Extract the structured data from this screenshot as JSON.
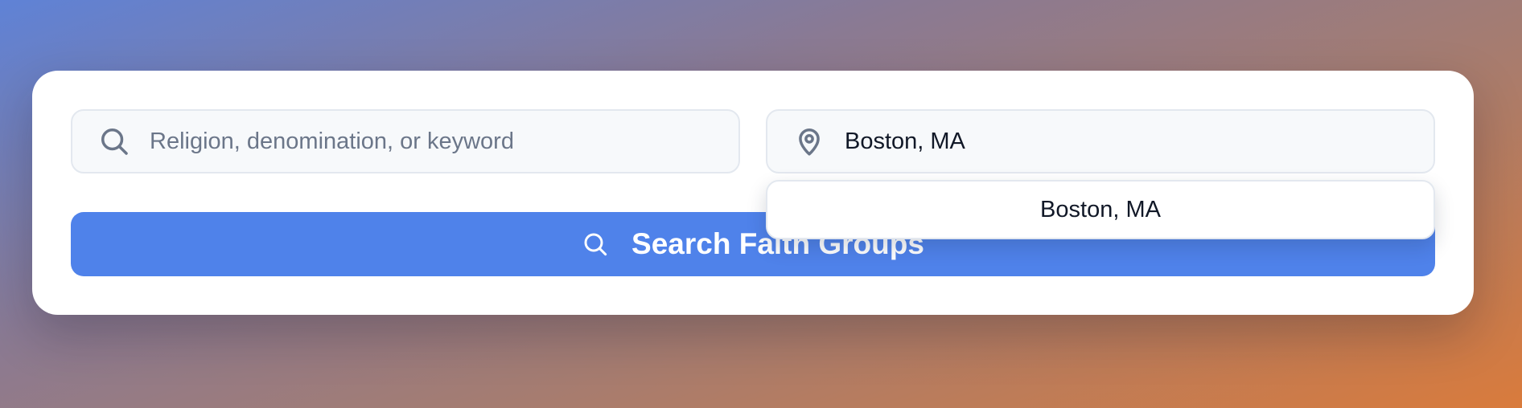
{
  "search_panel": {
    "keyword_field": {
      "icon": "search-icon",
      "placeholder": "Religion, denomination, or keyword",
      "value": ""
    },
    "location_field": {
      "icon": "map-pin-icon",
      "placeholder": "",
      "value": "Boston, MA"
    },
    "location_suggestions": [
      {
        "label": "Boston, MA"
      }
    ],
    "search_button": {
      "icon": "search-icon",
      "label": "Search Faith Groups"
    }
  },
  "colors": {
    "primary_button": "#4f82ea",
    "field_background": "#f7f9fb",
    "icon_gray": "#6b7689"
  }
}
